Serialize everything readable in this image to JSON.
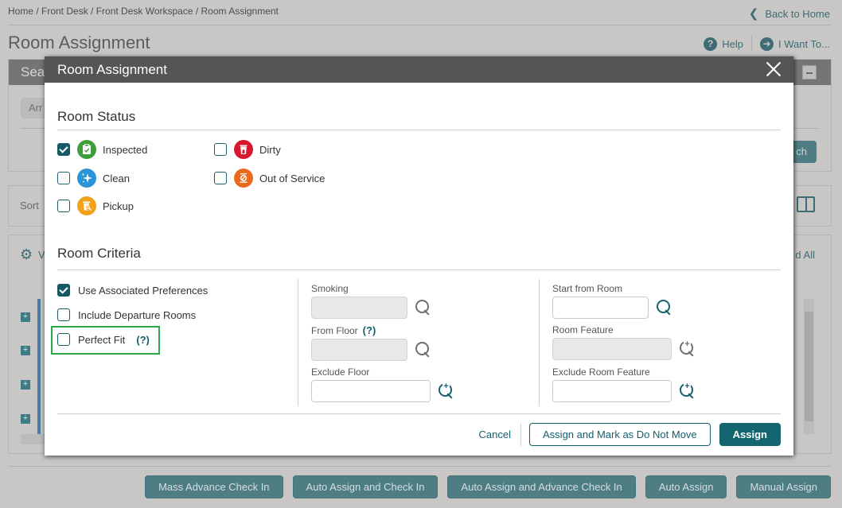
{
  "page": {
    "breadcrumb": "Home / Front Desk / Front Desk Workspace / Room Assignment",
    "back_link": "Back to Home",
    "title": "Room Assignment",
    "help_label": "Help",
    "i_want_to_label": "I Want To...",
    "search_panel_title": "Sear",
    "search_chip": "Arr",
    "search_button": "ch",
    "sort_label": "Sort",
    "view_label": "V",
    "expand_all_label": "d All",
    "bottom_buttons": [
      {
        "label": "Mass Advance Check In"
      },
      {
        "label": "Auto Assign and Check In"
      },
      {
        "label": "Auto Assign and Advance Check In"
      },
      {
        "label": "Auto Assign"
      },
      {
        "label": "Manual Assign"
      }
    ]
  },
  "modal": {
    "title": "Room Assignment",
    "room_status": {
      "heading": "Room Status",
      "options": [
        {
          "label": "Inspected",
          "checked": true,
          "icon": "clipboard-check-icon",
          "color": "#3f9e3a"
        },
        {
          "label": "Clean",
          "checked": false,
          "icon": "sparkle-icon",
          "color": "#2a95d6"
        },
        {
          "label": "Pickup",
          "checked": false,
          "icon": "trash-search-icon",
          "color": "#f0a21d"
        },
        {
          "label": "Dirty",
          "checked": false,
          "icon": "trash-bag-icon",
          "color": "#d7172f"
        },
        {
          "label": "Out of Service",
          "checked": false,
          "icon": "out-of-service-icon",
          "color": "#ea6a1e"
        }
      ]
    },
    "room_criteria": {
      "heading": "Room Criteria",
      "checkboxes": [
        {
          "label": "Use Associated Preferences",
          "checked": true
        },
        {
          "label": "Include Departure Rooms",
          "checked": false
        },
        {
          "label": "Perfect Fit",
          "checked": false,
          "help": "(?)"
        }
      ],
      "fields": {
        "smoking": {
          "label": "Smoking",
          "value": ""
        },
        "from_floor": {
          "label": "From Floor",
          "help": "(?)",
          "value": ""
        },
        "exclude_floor": {
          "label": "Exclude Floor",
          "value": ""
        },
        "start_from_room": {
          "label": "Start from Room",
          "value": ""
        },
        "room_feature": {
          "label": "Room Feature",
          "value": ""
        },
        "exclude_room_feature": {
          "label": "Exclude Room Feature",
          "value": ""
        }
      }
    },
    "actions": {
      "cancel": "Cancel",
      "assign_dnm": "Assign and Mark as Do Not Move",
      "assign": "Assign"
    }
  },
  "colors": {
    "accent": "#136670",
    "highlight_frame": "#2fa84a",
    "modal_header": "#555555"
  }
}
